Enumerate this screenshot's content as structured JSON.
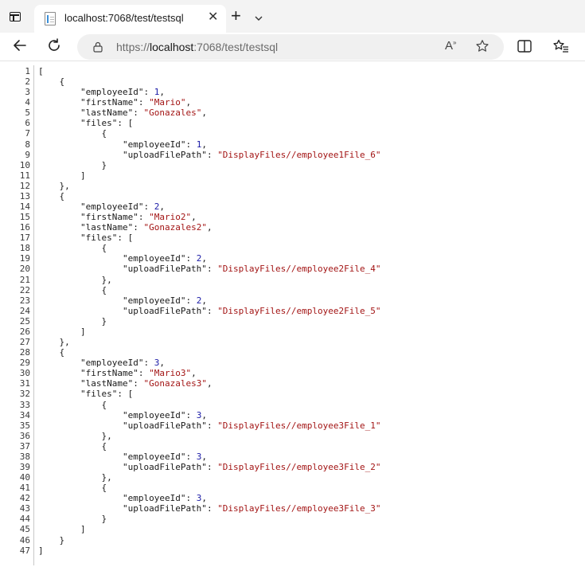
{
  "browser": {
    "tab": {
      "title": "localhost:7068/test/testsql"
    },
    "address": {
      "prefix": "https://",
      "host": "localhost",
      "rest": ":7068/test/testsql"
    },
    "read_aloud_label": "A",
    "read_aloud_sup": "»"
  },
  "json_lines": [
    [
      {
        "t": "p",
        "v": "["
      }
    ],
    [
      {
        "t": "p",
        "v": "    {"
      }
    ],
    [
      {
        "t": "p",
        "v": "        "
      },
      {
        "t": "k",
        "v": "\"employeeId\""
      },
      {
        "t": "p",
        "v": ": "
      },
      {
        "t": "n",
        "v": "1"
      },
      {
        "t": "p",
        "v": ","
      }
    ],
    [
      {
        "t": "p",
        "v": "        "
      },
      {
        "t": "k",
        "v": "\"firstName\""
      },
      {
        "t": "p",
        "v": ": "
      },
      {
        "t": "s",
        "v": "\"Mario\""
      },
      {
        "t": "p",
        "v": ","
      }
    ],
    [
      {
        "t": "p",
        "v": "        "
      },
      {
        "t": "k",
        "v": "\"lastName\""
      },
      {
        "t": "p",
        "v": ": "
      },
      {
        "t": "s",
        "v": "\"Gonazales\""
      },
      {
        "t": "p",
        "v": ","
      }
    ],
    [
      {
        "t": "p",
        "v": "        "
      },
      {
        "t": "k",
        "v": "\"files\""
      },
      {
        "t": "p",
        "v": ": ["
      }
    ],
    [
      {
        "t": "p",
        "v": "            {"
      }
    ],
    [
      {
        "t": "p",
        "v": "                "
      },
      {
        "t": "k",
        "v": "\"employeeId\""
      },
      {
        "t": "p",
        "v": ": "
      },
      {
        "t": "n",
        "v": "1"
      },
      {
        "t": "p",
        "v": ","
      }
    ],
    [
      {
        "t": "p",
        "v": "                "
      },
      {
        "t": "k",
        "v": "\"uploadFilePath\""
      },
      {
        "t": "p",
        "v": ": "
      },
      {
        "t": "s",
        "v": "\"DisplayFiles//employee1File_6\""
      }
    ],
    [
      {
        "t": "p",
        "v": "            }"
      }
    ],
    [
      {
        "t": "p",
        "v": "        ]"
      }
    ],
    [
      {
        "t": "p",
        "v": "    },"
      }
    ],
    [
      {
        "t": "p",
        "v": "    {"
      }
    ],
    [
      {
        "t": "p",
        "v": "        "
      },
      {
        "t": "k",
        "v": "\"employeeId\""
      },
      {
        "t": "p",
        "v": ": "
      },
      {
        "t": "n",
        "v": "2"
      },
      {
        "t": "p",
        "v": ","
      }
    ],
    [
      {
        "t": "p",
        "v": "        "
      },
      {
        "t": "k",
        "v": "\"firstName\""
      },
      {
        "t": "p",
        "v": ": "
      },
      {
        "t": "s",
        "v": "\"Mario2\""
      },
      {
        "t": "p",
        "v": ","
      }
    ],
    [
      {
        "t": "p",
        "v": "        "
      },
      {
        "t": "k",
        "v": "\"lastName\""
      },
      {
        "t": "p",
        "v": ": "
      },
      {
        "t": "s",
        "v": "\"Gonazales2\""
      },
      {
        "t": "p",
        "v": ","
      }
    ],
    [
      {
        "t": "p",
        "v": "        "
      },
      {
        "t": "k",
        "v": "\"files\""
      },
      {
        "t": "p",
        "v": ": ["
      }
    ],
    [
      {
        "t": "p",
        "v": "            {"
      }
    ],
    [
      {
        "t": "p",
        "v": "                "
      },
      {
        "t": "k",
        "v": "\"employeeId\""
      },
      {
        "t": "p",
        "v": ": "
      },
      {
        "t": "n",
        "v": "2"
      },
      {
        "t": "p",
        "v": ","
      }
    ],
    [
      {
        "t": "p",
        "v": "                "
      },
      {
        "t": "k",
        "v": "\"uploadFilePath\""
      },
      {
        "t": "p",
        "v": ": "
      },
      {
        "t": "s",
        "v": "\"DisplayFiles//employee2File_4\""
      }
    ],
    [
      {
        "t": "p",
        "v": "            },"
      }
    ],
    [
      {
        "t": "p",
        "v": "            {"
      }
    ],
    [
      {
        "t": "p",
        "v": "                "
      },
      {
        "t": "k",
        "v": "\"employeeId\""
      },
      {
        "t": "p",
        "v": ": "
      },
      {
        "t": "n",
        "v": "2"
      },
      {
        "t": "p",
        "v": ","
      }
    ],
    [
      {
        "t": "p",
        "v": "                "
      },
      {
        "t": "k",
        "v": "\"uploadFilePath\""
      },
      {
        "t": "p",
        "v": ": "
      },
      {
        "t": "s",
        "v": "\"DisplayFiles//employee2File_5\""
      }
    ],
    [
      {
        "t": "p",
        "v": "            }"
      }
    ],
    [
      {
        "t": "p",
        "v": "        ]"
      }
    ],
    [
      {
        "t": "p",
        "v": "    },"
      }
    ],
    [
      {
        "t": "p",
        "v": "    {"
      }
    ],
    [
      {
        "t": "p",
        "v": "        "
      },
      {
        "t": "k",
        "v": "\"employeeId\""
      },
      {
        "t": "p",
        "v": ": "
      },
      {
        "t": "n",
        "v": "3"
      },
      {
        "t": "p",
        "v": ","
      }
    ],
    [
      {
        "t": "p",
        "v": "        "
      },
      {
        "t": "k",
        "v": "\"firstName\""
      },
      {
        "t": "p",
        "v": ": "
      },
      {
        "t": "s",
        "v": "\"Mario3\""
      },
      {
        "t": "p",
        "v": ","
      }
    ],
    [
      {
        "t": "p",
        "v": "        "
      },
      {
        "t": "k",
        "v": "\"lastName\""
      },
      {
        "t": "p",
        "v": ": "
      },
      {
        "t": "s",
        "v": "\"Gonazales3\""
      },
      {
        "t": "p",
        "v": ","
      }
    ],
    [
      {
        "t": "p",
        "v": "        "
      },
      {
        "t": "k",
        "v": "\"files\""
      },
      {
        "t": "p",
        "v": ": ["
      }
    ],
    [
      {
        "t": "p",
        "v": "            {"
      }
    ],
    [
      {
        "t": "p",
        "v": "                "
      },
      {
        "t": "k",
        "v": "\"employeeId\""
      },
      {
        "t": "p",
        "v": ": "
      },
      {
        "t": "n",
        "v": "3"
      },
      {
        "t": "p",
        "v": ","
      }
    ],
    [
      {
        "t": "p",
        "v": "                "
      },
      {
        "t": "k",
        "v": "\"uploadFilePath\""
      },
      {
        "t": "p",
        "v": ": "
      },
      {
        "t": "s",
        "v": "\"DisplayFiles//employee3File_1\""
      }
    ],
    [
      {
        "t": "p",
        "v": "            },"
      }
    ],
    [
      {
        "t": "p",
        "v": "            {"
      }
    ],
    [
      {
        "t": "p",
        "v": "                "
      },
      {
        "t": "k",
        "v": "\"employeeId\""
      },
      {
        "t": "p",
        "v": ": "
      },
      {
        "t": "n",
        "v": "3"
      },
      {
        "t": "p",
        "v": ","
      }
    ],
    [
      {
        "t": "p",
        "v": "                "
      },
      {
        "t": "k",
        "v": "\"uploadFilePath\""
      },
      {
        "t": "p",
        "v": ": "
      },
      {
        "t": "s",
        "v": "\"DisplayFiles//employee3File_2\""
      }
    ],
    [
      {
        "t": "p",
        "v": "            },"
      }
    ],
    [
      {
        "t": "p",
        "v": "            {"
      }
    ],
    [
      {
        "t": "p",
        "v": "                "
      },
      {
        "t": "k",
        "v": "\"employeeId\""
      },
      {
        "t": "p",
        "v": ": "
      },
      {
        "t": "n",
        "v": "3"
      },
      {
        "t": "p",
        "v": ","
      }
    ],
    [
      {
        "t": "p",
        "v": "                "
      },
      {
        "t": "k",
        "v": "\"uploadFilePath\""
      },
      {
        "t": "p",
        "v": ": "
      },
      {
        "t": "s",
        "v": "\"DisplayFiles//employee3File_3\""
      }
    ],
    [
      {
        "t": "p",
        "v": "            }"
      }
    ],
    [
      {
        "t": "p",
        "v": "        ]"
      }
    ],
    [
      {
        "t": "p",
        "v": "    }"
      }
    ],
    [
      {
        "t": "p",
        "v": "]"
      }
    ]
  ],
  "colors": {
    "key": "#1a1a1a",
    "number": "#1a1aa6",
    "string": "#a31515",
    "line_number": "#3a3a3a"
  }
}
